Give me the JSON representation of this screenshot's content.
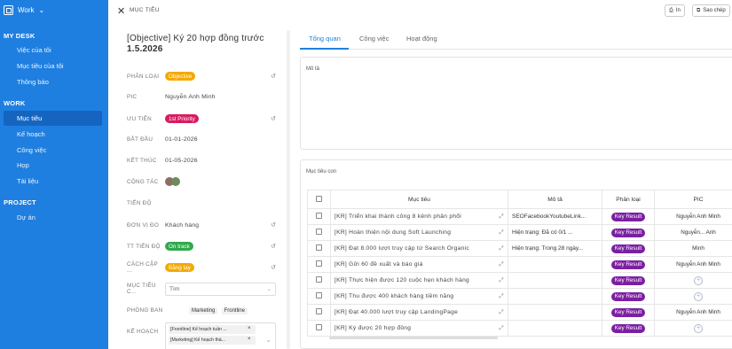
{
  "sidebar": {
    "workspace": "Work",
    "sections": [
      {
        "title": "MY DESK",
        "items": [
          {
            "label": "Việc của tôi"
          },
          {
            "label": "Mục tiêu của tôi"
          },
          {
            "label": "Thông báo"
          }
        ]
      },
      {
        "title": "WORK",
        "items": [
          {
            "label": "Mục tiêu"
          },
          {
            "label": "Kế hoạch"
          },
          {
            "label": "Công việc"
          },
          {
            "label": "Họp"
          },
          {
            "label": "Tài liệu"
          }
        ]
      },
      {
        "title": "PROJECT",
        "items": [
          {
            "label": "Dự án"
          }
        ]
      }
    ],
    "active_item": "Mục tiêu"
  },
  "topbar": {
    "breadcrumb": "MỤC TIÊU",
    "print_label": "In",
    "copy_label": "Sao chép"
  },
  "detail": {
    "title": "[Objective] Ký 20 hợp đồng trước",
    "title_date": "1.5.2026",
    "fields": {
      "type": {
        "label": "PHÂN LOẠI",
        "value": "Objective",
        "color": "#f4a900"
      },
      "pic": {
        "label": "PIC",
        "value": "Nguyễn Anh Minh"
      },
      "priority": {
        "label": "ƯU TIÊN",
        "value": "1st Priority",
        "color": "#d81b60"
      },
      "start": {
        "label": "BẮT ĐẦU",
        "value": "01-01-2026"
      },
      "end": {
        "label": "KẾT THÚC",
        "value": "01-05-2026"
      },
      "collab": {
        "label": "CỘNG TÁC"
      },
      "progress": {
        "label": "TIẾN ĐỘ"
      },
      "unit": {
        "label": "ĐƠN VỊ ĐO",
        "value": "Khách hàng"
      },
      "status": {
        "label": "TT TIẾN ĐỘ",
        "value": "On track",
        "color": "#2eaa4b"
      },
      "update": {
        "label": "CÁCH CẬP ...",
        "value": "Bằng tay",
        "color": "#f4a900"
      },
      "goal": {
        "label": "MỤC TIÊU C...",
        "placeholder": "Tìm"
      },
      "dept": {
        "label": "PHÒNG BAN",
        "tags": [
          "Marketing",
          "Frontline"
        ]
      },
      "plan": {
        "label": "KẾ HOẠCH",
        "tags": [
          "[Frontline] Kế hoạch tuần ...",
          "[Marketing] Kế hoạch thá..."
        ]
      }
    }
  },
  "tabs": [
    {
      "label": "Tổng quan"
    },
    {
      "label": "Công việc"
    },
    {
      "label": "Hoạt động"
    }
  ],
  "description": {
    "label": "Mô tả"
  },
  "subgoals": {
    "label": "Mục tiêu con",
    "columns": [
      "Mục tiêu",
      "Mô tả",
      "Phân loại",
      "PIC"
    ],
    "rows": [
      {
        "name": "[KR] Triển khai thành công 8 kênh phân phối",
        "desc": "SEOFacebookYoutubeLink...",
        "type": "Key Result",
        "pic": "Nguyễn Anh Minh"
      },
      {
        "name": "[KR] Hoàn thiện nội dung Soft Launching",
        "desc": "Hiện trạng: Đã có 0/1 ...",
        "type": "Key Result",
        "pic": "Nguyễn... Anh"
      },
      {
        "name": "[KR] Đạt 8.000 lượt truy cập từ Search Organic",
        "desc": "Hiện trạng: Trong 28 ngày...",
        "type": "Key Result",
        "pic": "Minh"
      },
      {
        "name": "[KR] Gửi 60 đề xuất và báo giá",
        "desc": "",
        "type": "Key Result",
        "pic": "Nguyễn Anh Minh"
      },
      {
        "name": "[KR] Thực hiện được 120 cuộc hẹn khách hàng",
        "desc": "",
        "type": "Key Result",
        "pic": ""
      },
      {
        "name": "[KR] Thu được 400 khách hàng tiềm năng",
        "desc": "",
        "type": "Key Result",
        "pic": ""
      },
      {
        "name": "[KR] Đạt 40.000 lượt truy cập LandingPage",
        "desc": "",
        "type": "Key Result",
        "pic": "Nguyễn Anh Minh"
      },
      {
        "name": "[KR] Ký được 20 hợp đồng",
        "desc": "",
        "type": "Key Result",
        "pic": ""
      }
    ]
  }
}
